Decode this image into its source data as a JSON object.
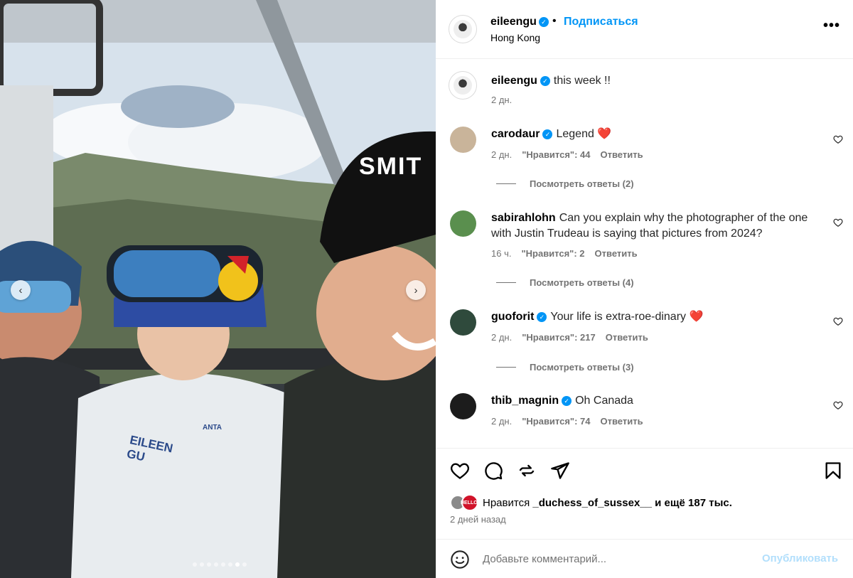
{
  "post": {
    "owner_username": "eileengu",
    "follow_label": "Подписаться",
    "location": "Hong Kong",
    "more_label": "•••"
  },
  "photo": {
    "helmet_text": "SMIT",
    "jacket_text_1": "EILEEN",
    "jacket_text_2": "GU",
    "brand_text": "ANTA",
    "carousel_dots": 8,
    "carousel_active_index": 6
  },
  "caption": {
    "username": "eileengu",
    "text": "this week !!",
    "time": "2 дн."
  },
  "comments": [
    {
      "username": "carodaur",
      "verified": true,
      "text": "Legend ❤️",
      "time": "2 дн.",
      "likes": "\"Нравится\": 44",
      "reply": "Ответить",
      "view_replies": "Посмотреть ответы (2)",
      "avatar_color": "#c9b49a"
    },
    {
      "username": "sabirahlohn",
      "verified": false,
      "text_line1": "Can you explain why the photographer of the one",
      "text_line2": "with Justin Trudeau is saying that pictures from 2024?",
      "time": "16 ч.",
      "likes": "\"Нравится\": 2",
      "reply": "Ответить",
      "view_replies": "Посмотреть ответы (4)",
      "avatar_color": "#5a8f4e"
    },
    {
      "username": "guoforit",
      "verified": true,
      "text": "Your life is extra-roe-dinary ❤️",
      "time": "2 дн.",
      "likes": "\"Нравится\": 217",
      "reply": "Ответить",
      "view_replies": "Посмотреть ответы (3)",
      "avatar_color": "#2f4a3c"
    },
    {
      "username": "thib_magnin",
      "verified": true,
      "text": "Oh Canada",
      "time": "2 дн.",
      "likes": "\"Нравится\": 74",
      "reply": "Ответить",
      "avatar_color": "#1c1c1c"
    }
  ],
  "likes": {
    "prefix": "Нравится",
    "user": "_duchess_of_sussex__",
    "suffix": "и ещё 187 тыс.",
    "badge_text": "HELLO!"
  },
  "time_ago": "2 дней назад",
  "comment_box": {
    "placeholder": "Добавьте комментарий...",
    "publish_label": "Опубликовать"
  },
  "colors": {
    "accent": "#0095f6",
    "muted": "#737373",
    "publish_disabled": "#b2dffc",
    "heart_red": "#e0002a"
  },
  "icons": {
    "like": "heart-icon",
    "comment": "comment-icon",
    "repost": "repost-icon",
    "share": "send-icon",
    "save": "bookmark-icon",
    "emoji": "emoji-icon",
    "verified": "verified-badge-icon",
    "more": "more-options-icon"
  }
}
